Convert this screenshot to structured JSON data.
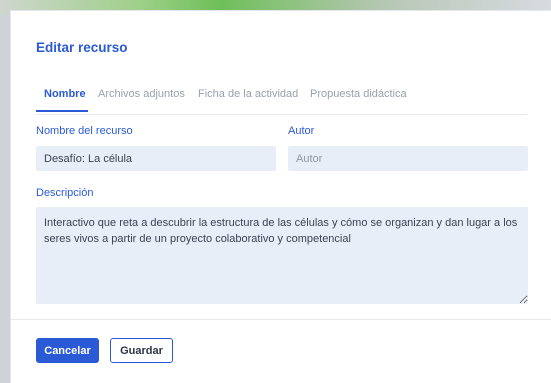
{
  "dialog": {
    "title": "Editar recurso",
    "tabs": [
      {
        "label": "Nombre",
        "active": true
      },
      {
        "label": "Archivos adjuntos",
        "active": false
      },
      {
        "label": "Ficha de la actividad",
        "active": false
      },
      {
        "label": "Propuesta didáctica",
        "active": false
      }
    ],
    "fields": {
      "resource_name": {
        "label": "Nombre del recurso",
        "value": "Desafío: La célula"
      },
      "author": {
        "label": "Autor",
        "value": "",
        "placeholder": "Autor"
      },
      "description": {
        "label": "Descripción",
        "value": "Interactivo que reta a descubrir la estructura de las células y cómo se organizan y dan lugar a los seres vivos a partir de un proyecto colaborativo y competencial"
      }
    },
    "buttons": {
      "cancel": "Cancelar",
      "save": "Guardar"
    }
  },
  "colors": {
    "accent": "#2b5ad6",
    "input_bg": "#e8eef8",
    "muted_tab": "#9aa1ab"
  }
}
